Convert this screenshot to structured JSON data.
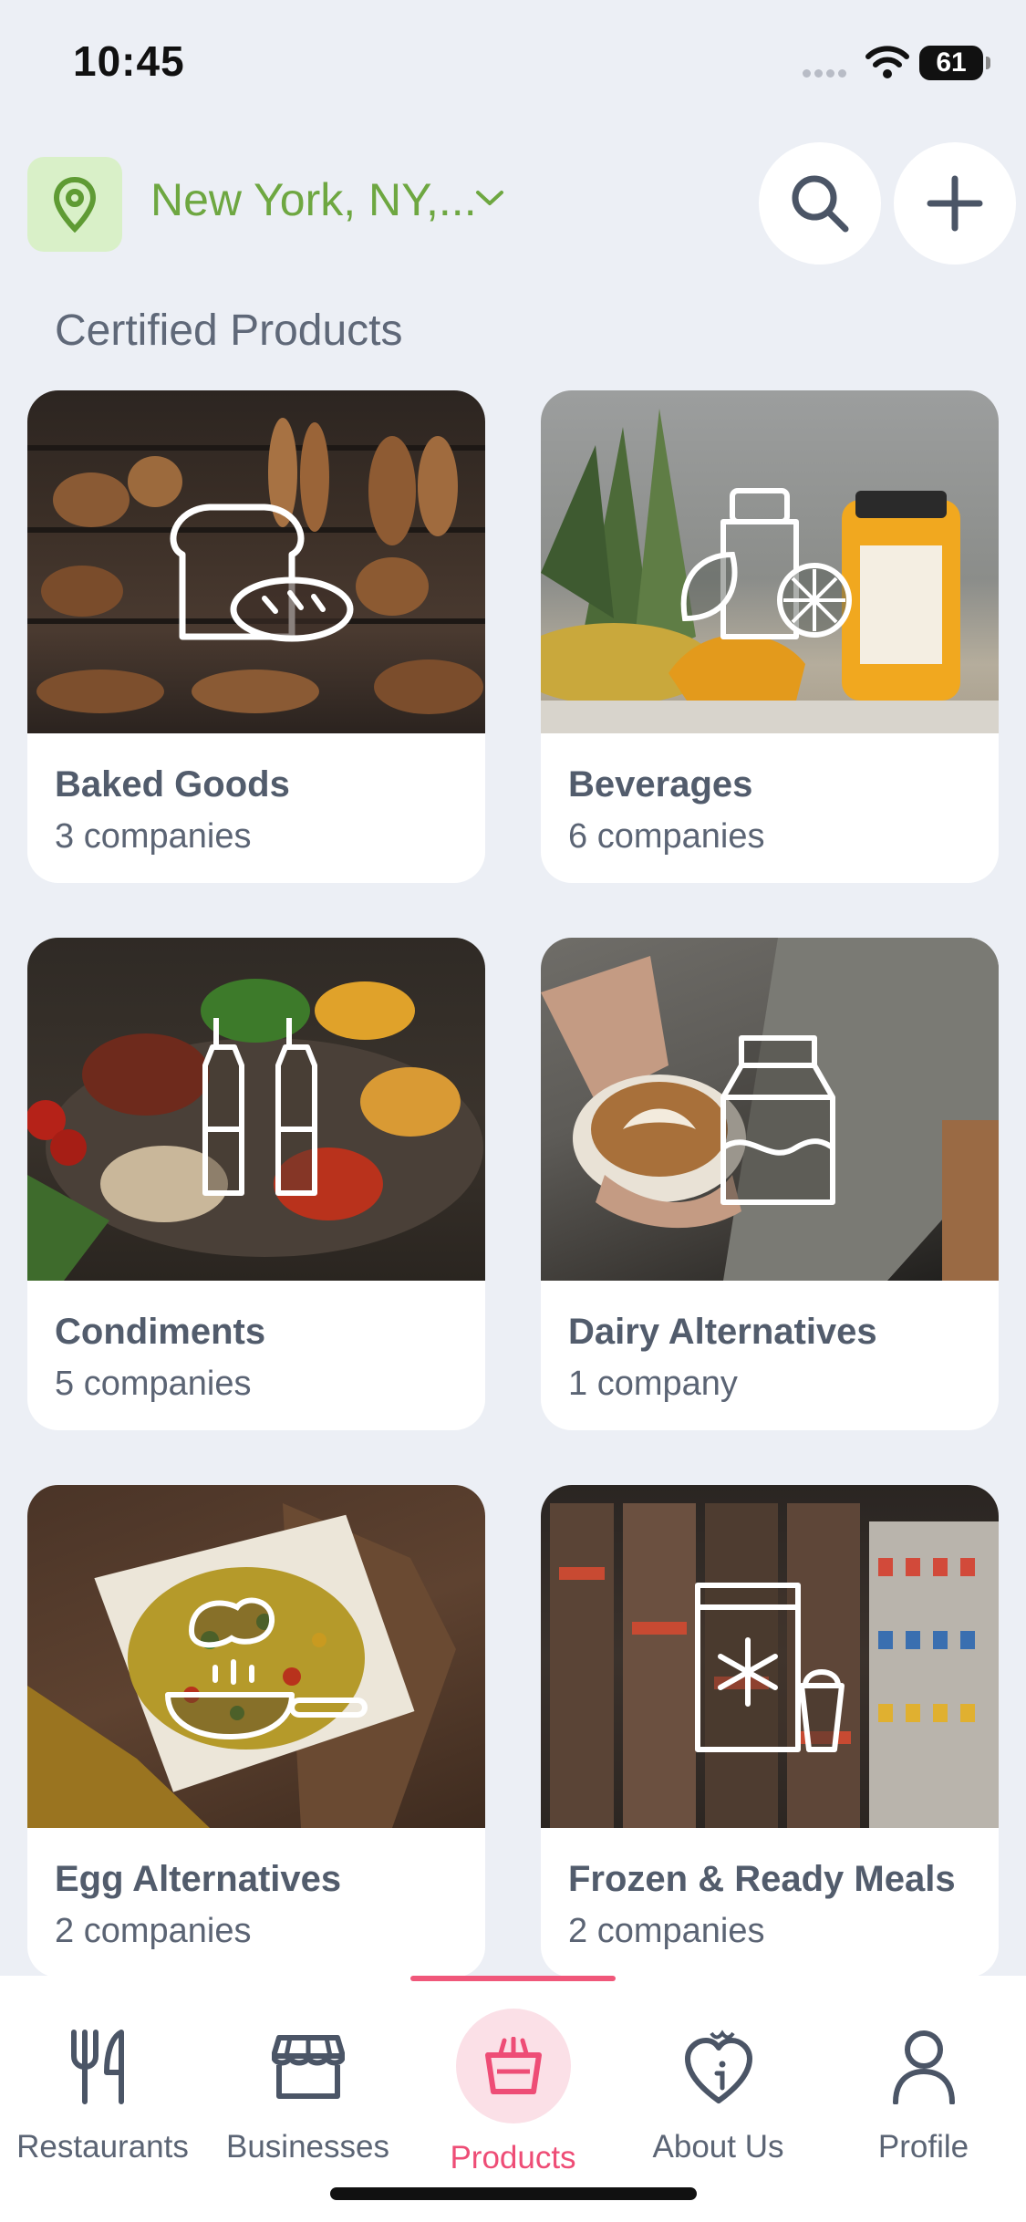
{
  "status": {
    "time": "10:45",
    "battery": "61"
  },
  "header": {
    "location": "New York, NY,..."
  },
  "section_title": "Certified Products",
  "categories": [
    {
      "name": "Baked Goods",
      "count": "3 companies",
      "icon": "bread-icon"
    },
    {
      "name": "Beverages",
      "count": "6 companies",
      "icon": "bottle-leaf-icon"
    },
    {
      "name": "Condiments",
      "count": "5 companies",
      "icon": "condiment-bottles-icon"
    },
    {
      "name": "Dairy Alternatives",
      "count": "1 company",
      "icon": "milk-carton-icon"
    },
    {
      "name": "Egg Alternatives",
      "count": "2 companies",
      "icon": "frying-pan-icon"
    },
    {
      "name": "Frozen & Ready Meals",
      "count": "2 companies",
      "icon": "frozen-bag-icon"
    }
  ],
  "tabs": [
    {
      "label": "Restaurants",
      "icon": "fork-knife-icon"
    },
    {
      "label": "Businesses",
      "icon": "storefront-icon"
    },
    {
      "label": "Products",
      "icon": "grocery-basket-icon"
    },
    {
      "label": "About Us",
      "icon": "heart-info-icon"
    },
    {
      "label": "Profile",
      "icon": "person-icon"
    }
  ],
  "colors": {
    "accent_green": "#6ea741",
    "accent_pink": "#ee4d76",
    "background": "#eceff5"
  }
}
